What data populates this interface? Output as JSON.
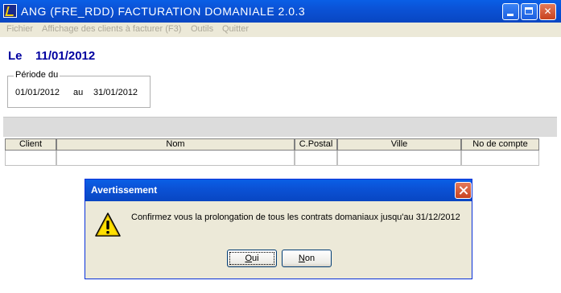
{
  "window": {
    "title": "ANG  (FRE_RDD) FACTURATION DOMANIALE 2.0.3",
    "controls": [
      "minimize",
      "maximize",
      "close"
    ]
  },
  "menu": {
    "items": [
      "Fichier",
      "Affichage des clients à facturer (F3)",
      "Outils",
      "Quitter"
    ]
  },
  "header": {
    "date_label": "Le",
    "date_value": "11/01/2012"
  },
  "period": {
    "legend": "Période du",
    "from": "01/01/2012",
    "separator": "au",
    "to": "31/01/2012"
  },
  "table": {
    "columns": [
      "Client",
      "Nom",
      "C.Postal",
      "Ville",
      "No de compte"
    ],
    "rows": []
  },
  "dialog": {
    "title": "Avertissement",
    "icon": "warning-icon",
    "message": "Confirmez vous la prolongation de tous les contrats domaniaux jusqu'au 31/12/2012",
    "buttons": {
      "yes_first": "O",
      "yes_rest": "ui",
      "no_first": "N",
      "no_rest": "on"
    }
  },
  "colors": {
    "title_bar": "#0a5fe6",
    "date_text": "#0000a0",
    "dialog_bg": "#ece9d8"
  }
}
